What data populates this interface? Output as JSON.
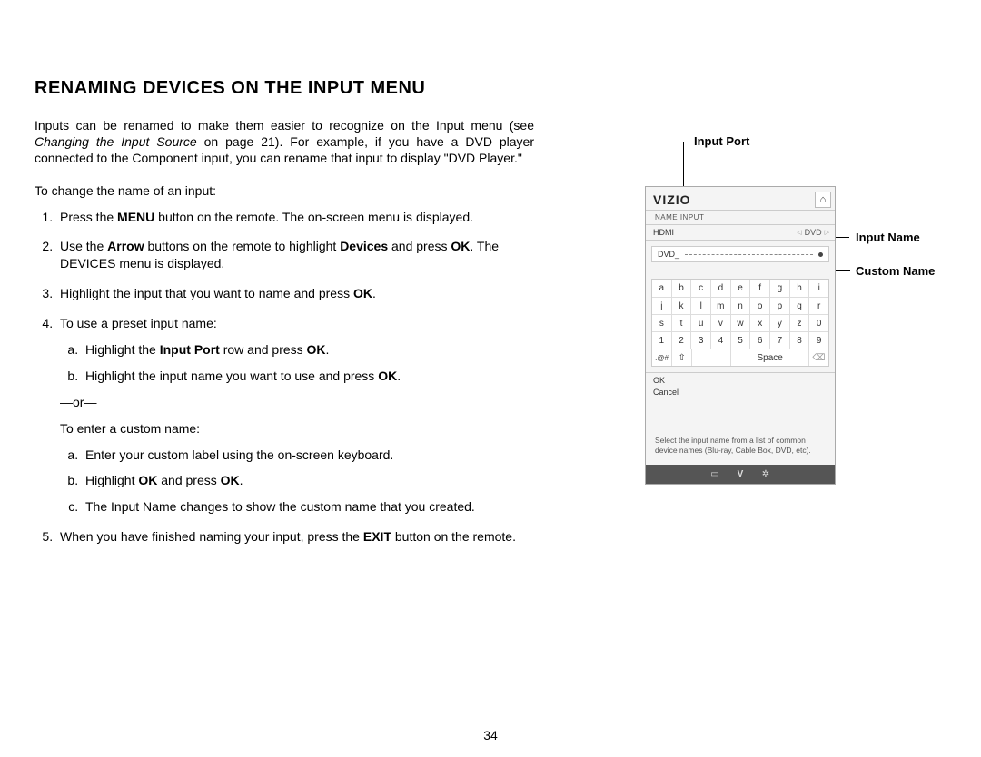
{
  "title": "RENAMING DEVICES ON THE INPUT MENU",
  "intro_pre": "Inputs can be renamed to make them easier to recognize on the Input menu (see ",
  "intro_em": "Changing the Input Source",
  "intro_post": " on page 21). For example, if you have a DVD player connected to the Component input, you can rename that input to display \"DVD Player.\"",
  "lead": "To change the name of an input:",
  "steps": {
    "s1a": "Press the ",
    "s1b": "MENU",
    "s1c": " button on the remote. The on-screen menu is displayed.",
    "s2a": "Use the ",
    "s2b": "Arrow",
    "s2c": " buttons on the remote to highlight ",
    "s2d": "Devices",
    "s2e": " and press ",
    "s2f": "OK",
    "s2g": ". The DEVICES menu is displayed.",
    "s3a": "Highlight the input that you want to name and press ",
    "s3b": "OK",
    "s3c": ".",
    "s4": "To use a preset input name:",
    "s4aa": "Highlight the ",
    "s4ab": "Input Port",
    "s4ac": " row and press ",
    "s4ad": "OK",
    "s4ae": ".",
    "s4ba": "Highlight the input name you want to use and press ",
    "s4bb": "OK",
    "s4bc": ".",
    "or": "—or—",
    "s4lead2": "To enter a custom name:",
    "s4ca": "Enter your custom label using the on-screen keyboard.",
    "s4da": "Highlight ",
    "s4db": "OK",
    "s4dc": " and press ",
    "s4dd": "OK",
    "s4de": ".",
    "s4ea": "The Input Name changes to show the custom name that you created.",
    "s5a": "When you have finished naming your input, press the ",
    "s5b": "EXIT",
    "s5c": " button on the remote."
  },
  "callouts": {
    "port": "Input Port",
    "name": "Input Name",
    "custom": "Custom Name"
  },
  "device": {
    "logo": "VIZIO",
    "subtitle": "NAME INPUT",
    "port_label": "HDMI",
    "port_value": "DVD",
    "custom_value": "DVD_",
    "ok": "OK",
    "cancel": "Cancel",
    "hint": "Select the input name from a list of common device names (Blu-ray, Cable Box, DVD, etc).",
    "space": "Space",
    "sym": ".@#",
    "kb": {
      "r1": [
        "a",
        "b",
        "c",
        "d",
        "e",
        "f",
        "g",
        "h",
        "i"
      ],
      "r2": [
        "j",
        "k",
        "l",
        "m",
        "n",
        "o",
        "p",
        "q",
        "r"
      ],
      "r3": [
        "s",
        "t",
        "u",
        "v",
        "w",
        "x",
        "y",
        "z",
        "0"
      ],
      "r4": [
        "1",
        "2",
        "3",
        "4",
        "5",
        "6",
        "7",
        "8",
        "9"
      ]
    }
  },
  "page_number": "34"
}
